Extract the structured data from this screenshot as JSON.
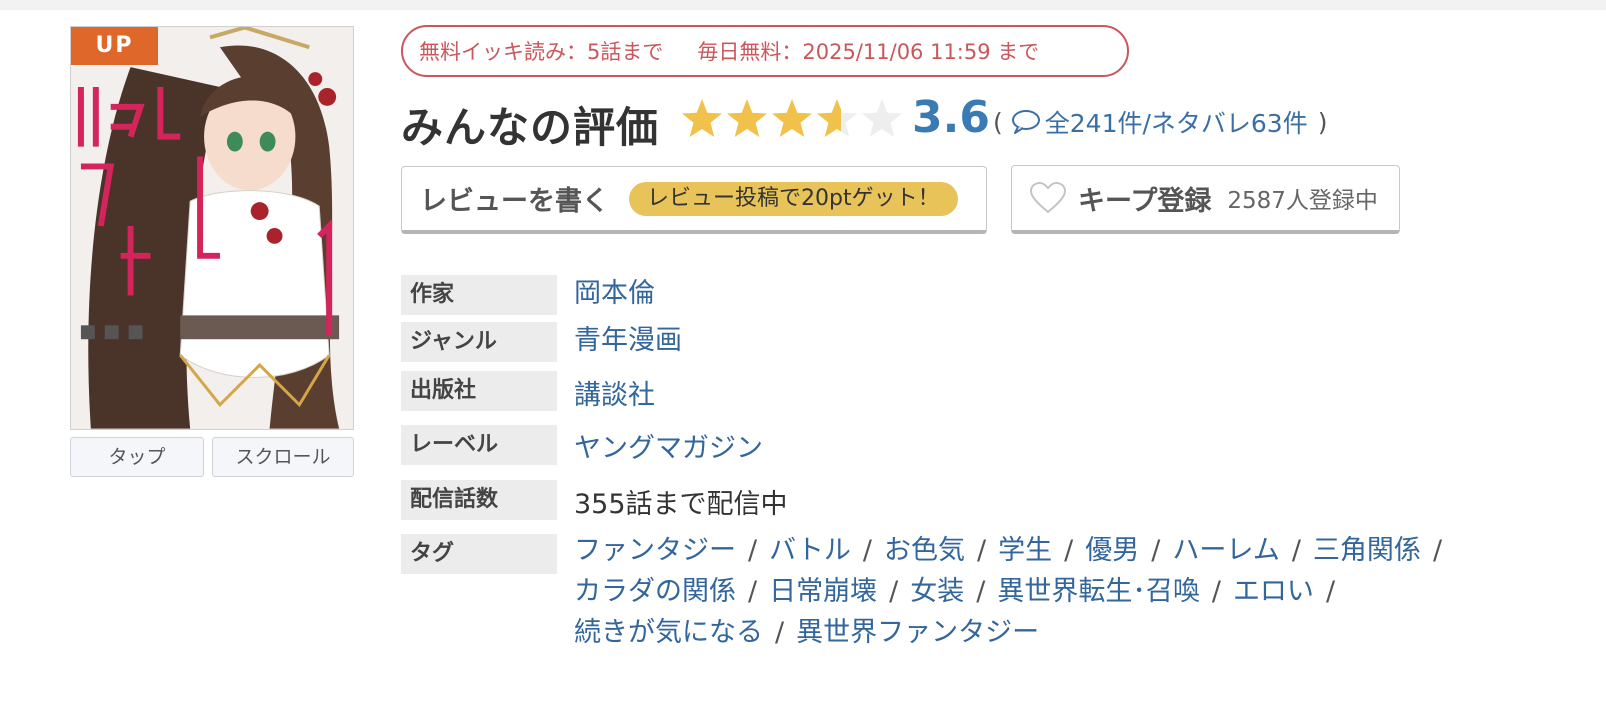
{
  "cover": {
    "badge": "UP",
    "tap_button": "タップ",
    "scroll_button": "スクロール"
  },
  "free_info": {
    "ikki": "無料イッキ読み：5話まで",
    "daily": "毎日無料：2025/11/06 11:59 まで"
  },
  "rating": {
    "title": "みんなの評価",
    "score": "3.6",
    "score_value": 3.6,
    "max_stars": 5,
    "open_paren": "(",
    "reviews_text": "全241件/ネタバレ63件",
    "close_paren": ")",
    "star_color": "#f0c24b",
    "star_empty_color": "#eeeeee"
  },
  "actions": {
    "write_review": "レビューを書く",
    "points_badge": "レビュー投稿で20ptゲット！",
    "keep": "キープ登録",
    "keep_count": "2587人登録中"
  },
  "info": {
    "author_label": "作家",
    "author": "岡本倫",
    "genre_label": "ジャンル",
    "genre": "青年漫画",
    "publisher_label": "出版社",
    "publisher": "講談社",
    "label_label": "レーベル",
    "label": "ヤングマガジン",
    "episodes_label": "配信話数",
    "episodes": "355話まで配信中",
    "tags_label": "タグ"
  },
  "tags": [
    "ファンタジー",
    "バトル",
    "お色気",
    "学生",
    "優男",
    "ハーレム",
    "三角関係",
    "カラダの関係",
    "日常崩壊",
    "女装",
    "異世界転生･召喚",
    "エロい",
    "続きが気になる",
    "異世界ファンタジー"
  ],
  "tag_separator": "/",
  "colors": {
    "link": "#33669c",
    "accent_red": "#c9575b",
    "score_blue": "#3a7bb3",
    "badge_orange": "#e0672a",
    "points_yellow": "#e8c35a"
  }
}
